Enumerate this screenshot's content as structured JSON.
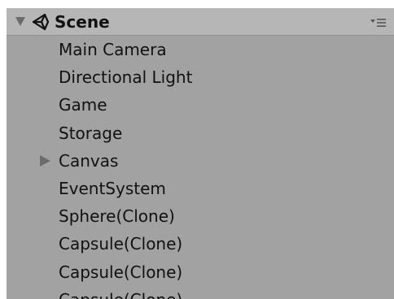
{
  "colors": {
    "panel_background": "#a2a2a2",
    "header_background": "#b6b6b6",
    "text": "#111111",
    "arrow": "#6c6c6c"
  },
  "header": {
    "title": "Scene",
    "scene_icon": "unity-logo-icon",
    "menu_icon": "options-menu-icon",
    "expanded": true
  },
  "hierarchy": {
    "items": [
      {
        "label": "Main Camera",
        "has_children": false
      },
      {
        "label": "Directional Light",
        "has_children": false
      },
      {
        "label": "Game",
        "has_children": false
      },
      {
        "label": "Storage",
        "has_children": false
      },
      {
        "label": "Canvas",
        "has_children": true,
        "expanded": false
      },
      {
        "label": "EventSystem",
        "has_children": false
      },
      {
        "label": "Sphere(Clone)",
        "has_children": false
      },
      {
        "label": "Capsule(Clone)",
        "has_children": false
      },
      {
        "label": "Capsule(Clone)",
        "has_children": false
      },
      {
        "label": "Capsule(Clone)",
        "has_children": false
      }
    ]
  }
}
